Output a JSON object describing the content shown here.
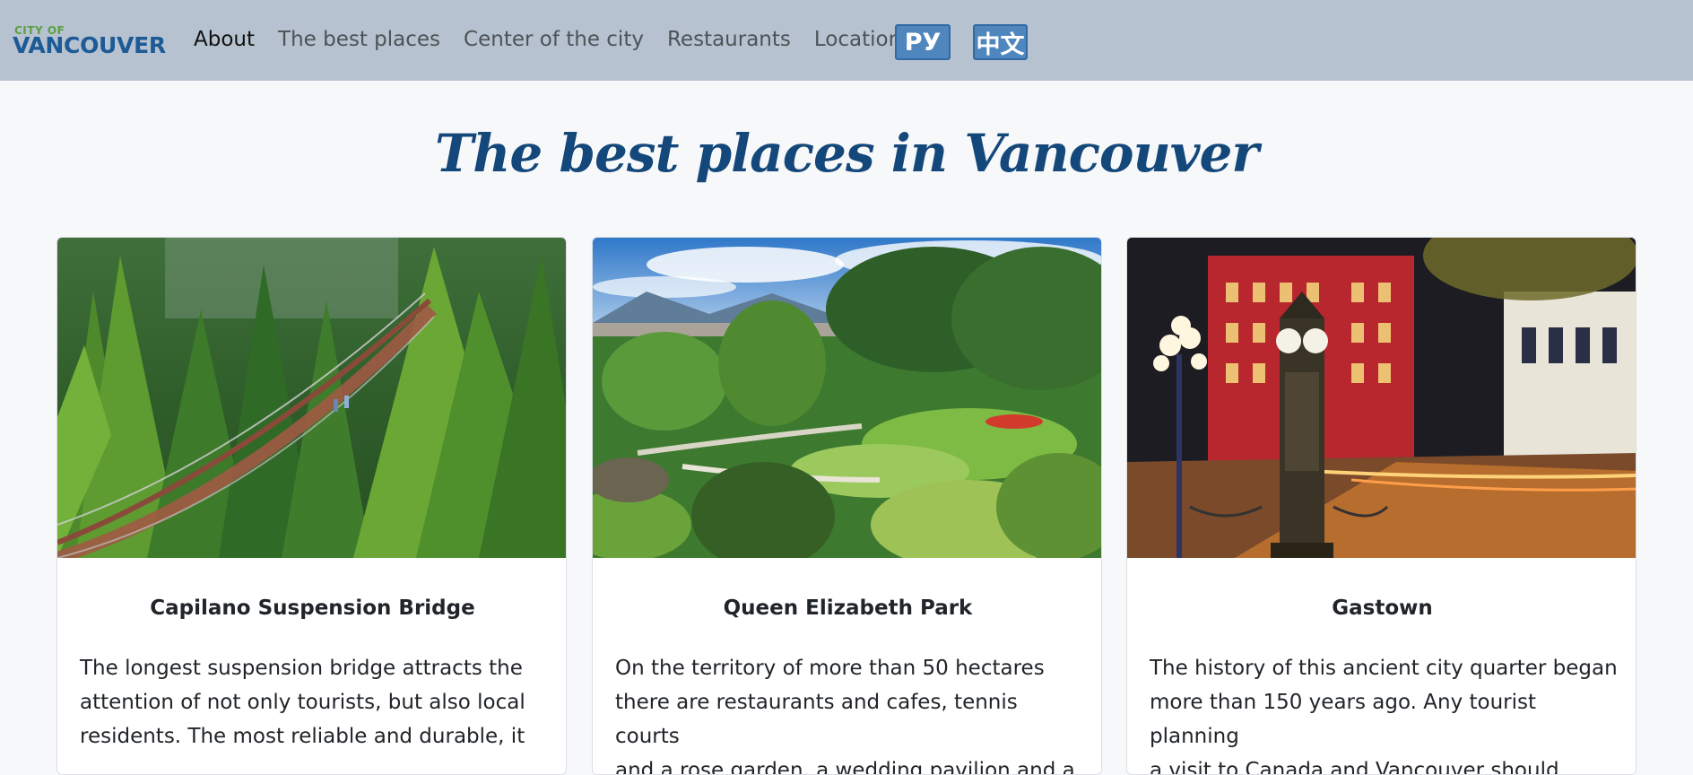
{
  "logo": {
    "top_text": "CITY OF",
    "main_text": "VANCOUVER"
  },
  "nav": {
    "items": [
      {
        "label": "About"
      },
      {
        "label": "The best places"
      },
      {
        "label": "Center of the city"
      },
      {
        "label": "Restaurants"
      },
      {
        "label": "Location"
      }
    ],
    "lang_ru": "РУ",
    "lang_zh": "中文"
  },
  "page": {
    "title": "The best places in Vancouver"
  },
  "cards": [
    {
      "title": "Capilano Suspension Bridge",
      "text": "The longest suspension bridge attracts the\nattention of not only tourists, but also local\nresidents. The most reliable and durable, it"
    },
    {
      "title": "Queen Elizabeth Park",
      "text": "On the territory of more than 50 hectares\nthere are restaurants and cafes, tennis courts\nand a rose garden, a wedding pavilion and a"
    },
    {
      "title": "Gastown",
      "text": "The history of this ancient city quarter began\nmore than 150 years ago. Any tourist planning\na visit to Canada and Vancouver should"
    }
  ],
  "colors": {
    "navbar_bg": "#b6c2cf",
    "title_color": "#14477a",
    "lang_button_bg": "#4f86bd",
    "logo_green": "#5aa041",
    "logo_blue": "#1d5a96"
  }
}
